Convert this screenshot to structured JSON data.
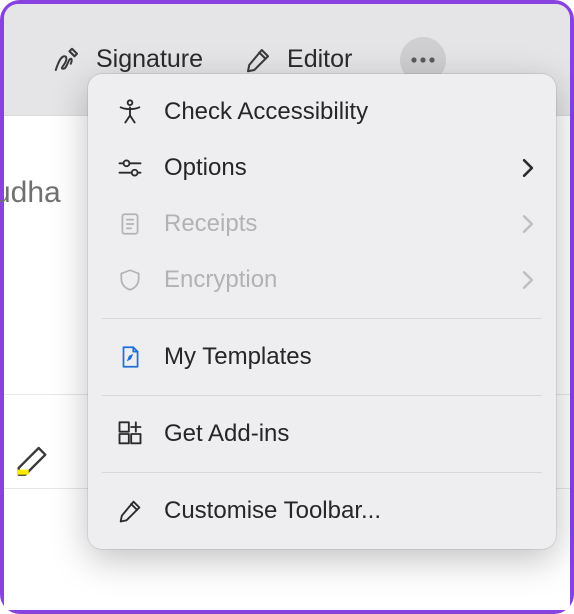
{
  "toolbar": {
    "signature_label": "Signature",
    "editor_label": "Editor"
  },
  "menu": {
    "check_accessibility": "Check Accessibility",
    "options": "Options",
    "receipts": "Receipts",
    "encryption": "Encryption",
    "my_templates": "My Templates",
    "get_addins": "Get Add-ins",
    "customise_toolbar": "Customise Toolbar..."
  },
  "background": {
    "partial_text": "udha"
  }
}
